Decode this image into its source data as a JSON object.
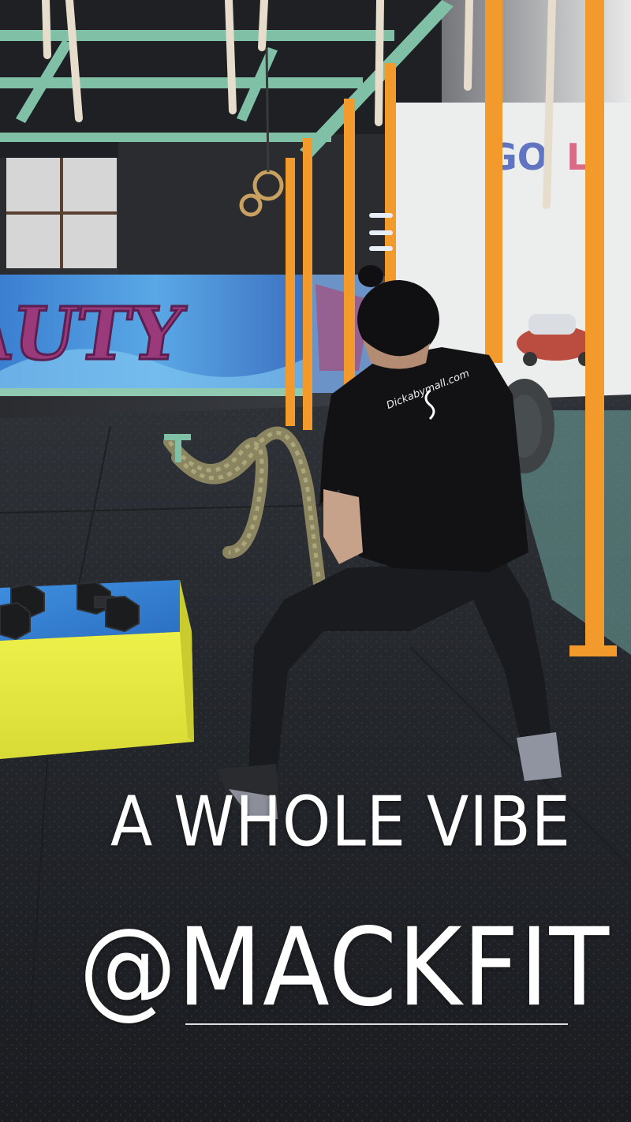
{
  "story": {
    "caption_line_1": "A WHOLE VIBE",
    "caption_line_2": "@MACKFIT",
    "text_color": "#ffffff"
  },
  "scene": {
    "description_hidden": "",
    "shirt_print": "Dickabymall.com",
    "colors": {
      "frame_green": "#6fb59a",
      "frame_orange": "#f29a2b",
      "box_yellow": "#e6e640",
      "box_blue": "#2c78c8",
      "floor": "#26292e",
      "shirt": "#121214"
    }
  }
}
